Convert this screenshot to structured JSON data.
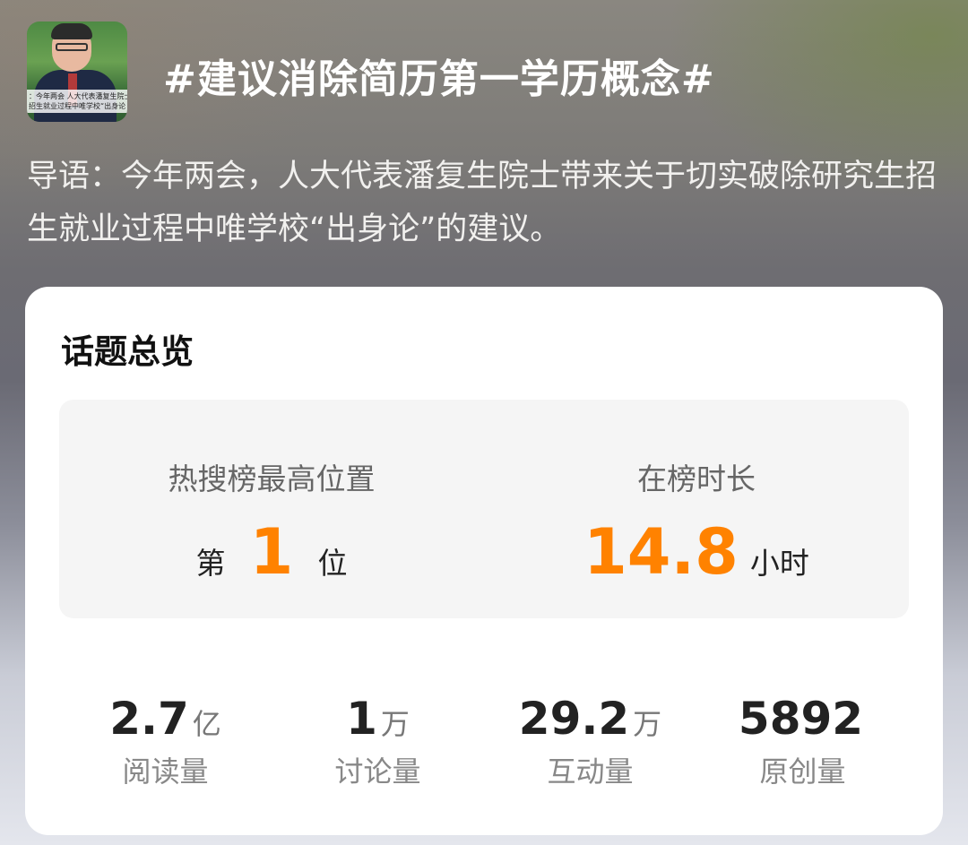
{
  "header": {
    "title": "#建议消除简历第一学历概念#",
    "thumb_caption_1": "：今年两会 人大代表潘复生院士",
    "thumb_caption_2": "招生就业过程中唯学校“出身论"
  },
  "intro": {
    "text": "导语：今年两会，人大代表潘复生院士带来关于切实破除研究生招生就业过程中唯学校“出身论”的建议。"
  },
  "card": {
    "title": "话题总览",
    "highest_position": {
      "label": "热搜榜最高位置",
      "prefix": "第",
      "value": "1",
      "suffix": "位"
    },
    "time_on_list": {
      "label": "在榜时长",
      "value": "14.8",
      "unit": "小时"
    },
    "stats": [
      {
        "value": "2.7",
        "unit": "亿",
        "label": "阅读量"
      },
      {
        "value": "1",
        "unit": "万",
        "label": "讨论量"
      },
      {
        "value": "29.2",
        "unit": "万",
        "label": "互动量"
      },
      {
        "value": "5892",
        "unit": "",
        "label": "原创量"
      }
    ],
    "accent_color": "#ff8200"
  }
}
